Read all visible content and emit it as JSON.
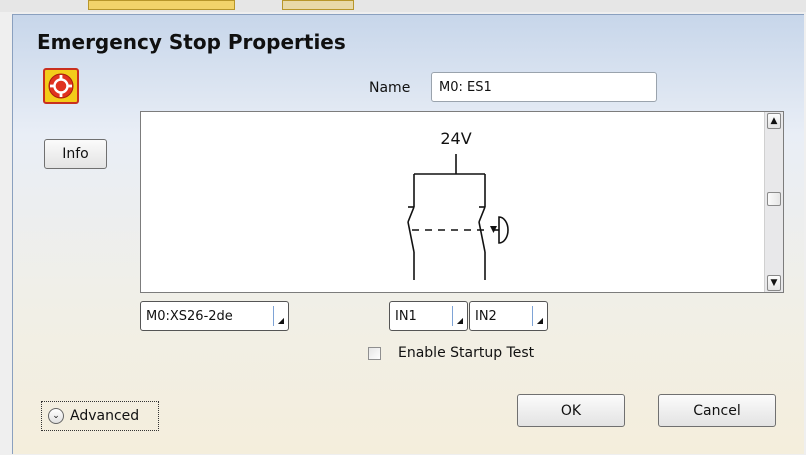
{
  "dialog": {
    "title": "Emergency Stop Properties",
    "icon": "emergency-stop-icon",
    "info_label": "Info",
    "name_label": "Name",
    "name_value": "M0: ES1"
  },
  "schematic": {
    "voltage_label": "24V"
  },
  "selectors": {
    "module_value": "M0:XS26-2de",
    "input1_value": "IN1",
    "input2_value": "IN2"
  },
  "options": {
    "startup_test_label": "Enable Startup Test",
    "startup_test_checked": false
  },
  "footer": {
    "advanced_label": "Advanced",
    "ok_label": "OK",
    "cancel_label": "Cancel"
  },
  "colors": {
    "icon_yellow": "#f3cc1a",
    "icon_red": "#e0321f",
    "accent_blue": "#7ea3d6"
  }
}
